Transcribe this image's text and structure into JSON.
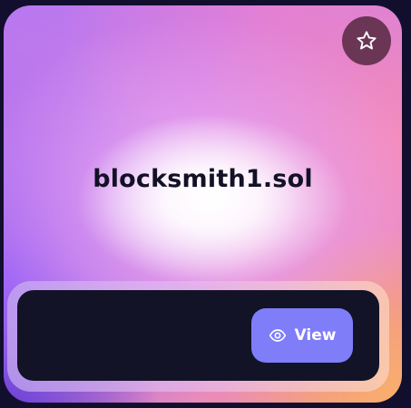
{
  "card": {
    "domain_name": "blocksmith1.sol",
    "favorite": {
      "icon": "star-outline-icon"
    },
    "actions": {
      "view_label": "View",
      "view_icon": "eye-icon",
      "accent_color": "#7f7df8"
    }
  }
}
